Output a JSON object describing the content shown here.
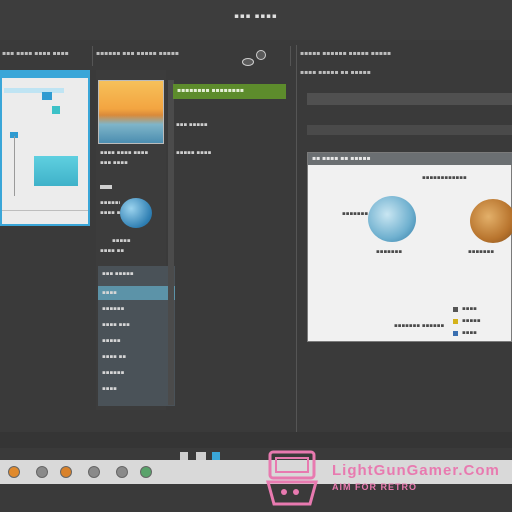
{
  "window": {
    "title": "▪▪▪ ▪▪▪▪"
  },
  "toolbar": {
    "left_labels": [
      "▪▪▪ ▪▪▪▪ ▪▪▪▪ ▪▪▪▪"
    ],
    "mid_labels": [
      "▪▪▪▪▪▪ ▪▪▪ ▪▪▪▪▪ ▪▪▪▪▪",
      "▪▪▪ ▪▪▪ ▪▪▪▪ ▪▪▪▪▪"
    ],
    "right_labels": [
      "▪▪▪▪▪ ▪▪▪▪▪▪ ▪▪▪▪▪ ▪▪▪▪▪",
      "▪▪▪▪ ▪▪▪▪▪ ▪▪ ▪▪▪▪▪"
    ]
  },
  "middle": {
    "caption1": "▪▪▪▪ ▪▪▪▪ ▪▪▪▪",
    "caption2": "▪▪▪ ▪▪▪▪",
    "list_header": "▪▪▪ ▪▪▪▪▪",
    "list_selected": "▪▪▪▪",
    "list_items": [
      "▪▪▪▪▪▪",
      "▪▪▪▪ ▪▪▪",
      "▪▪▪▪▪",
      "▪▪▪▪ ▪▪",
      "▪▪▪▪▪▪",
      "▪▪▪▪"
    ]
  },
  "green_panel": {
    "label": "▪▪▪▪▪▪▪▪ ▪▪▪▪▪▪▪▪"
  },
  "side_labels": {
    "row1": "▪▪▪ ▪▪▪▪▪",
    "row2": "▪▪▪▪▪ ▪▪▪▪"
  },
  "dialog": {
    "title": "▪▪ ▪▪▪▪ ▪▪ ▪▪▪▪▪",
    "top_note": "▪▪▪▪▪▪▪▪▪▪▪▪",
    "left_label": "▪▪▪▪▪▪▪",
    "left_caption": "▪▪▪▪▪▪▪",
    "right_caption": "▪▪▪▪▪▪▪",
    "bottom_left": "▪▪▪▪▪▪▪ ▪▪▪▪▪▪",
    "legend": [
      "▪▪▪▪",
      "▪▪▪▪▪",
      "▪▪▪▪"
    ],
    "legend_colors": [
      "#555555",
      "#d4b21a",
      "#3a6fb0"
    ]
  },
  "watermark": {
    "line1": "LightGunGamer.Com",
    "line2": "AIM FOR RETRO"
  },
  "colors": {
    "accent_blue": "#3aa6d8",
    "green_bar": "#5d8c2c",
    "watermark_pink": "#e87ab0"
  }
}
